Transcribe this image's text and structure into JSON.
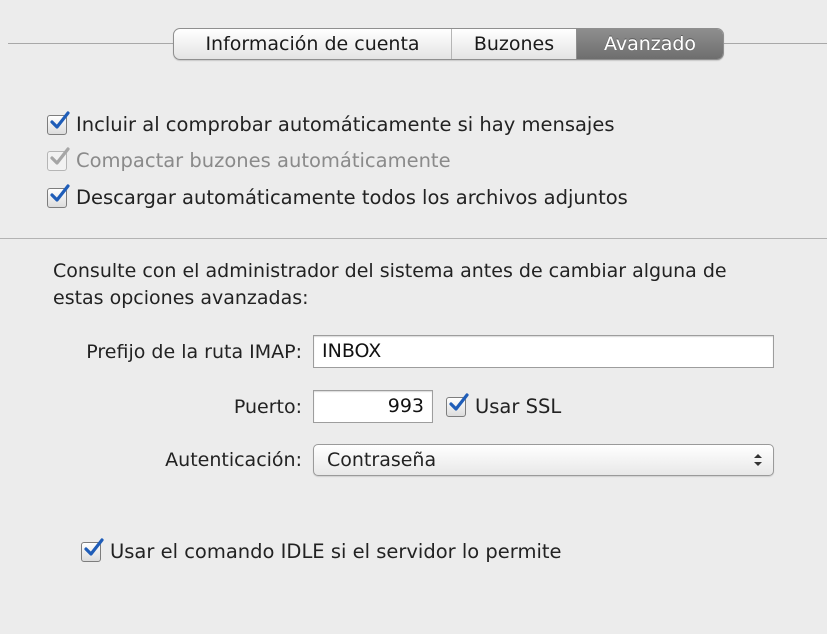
{
  "tabs": [
    {
      "label": "Información de cuenta",
      "selected": false
    },
    {
      "label": "Buzones",
      "selected": false
    },
    {
      "label": "Avanzado",
      "selected": true
    }
  ],
  "options": {
    "include_auto_check": {
      "label": "Incluir al comprobar automáticamente si hay mensajes",
      "checked": true,
      "enabled": true
    },
    "compact_mailboxes": {
      "label": "Compactar buzones automáticamente",
      "checked": true,
      "enabled": false
    },
    "download_attachments": {
      "label": "Descargar automáticamente todos los archivos adjuntos",
      "checked": true,
      "enabled": true
    }
  },
  "advanced": {
    "note": "Consulte con el administrador del sistema antes de cambiar alguna de estas opciones avanzadas:",
    "imap_prefix_label": "Prefijo de la ruta IMAP:",
    "imap_prefix_value": "INBOX",
    "port_label": "Puerto:",
    "port_value": "993",
    "ssl_label": "Usar SSL",
    "ssl_checked": true,
    "auth_label": "Autenticación:",
    "auth_value": "Contraseña",
    "idle_label": "Usar el comando IDLE si el servidor lo permite",
    "idle_checked": true
  },
  "colors": {
    "selected_tab": "#7e7e7e",
    "checkmark": "#1f5db8",
    "checkmark_disabled": "#a6a6a6"
  }
}
